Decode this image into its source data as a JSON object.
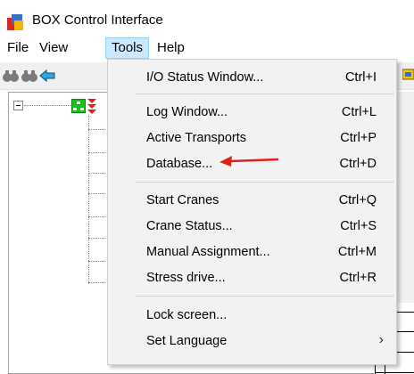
{
  "window": {
    "title": "BOX Control Interface"
  },
  "menubar": {
    "file": "File",
    "view": "View",
    "tools": "Tools",
    "help": "Help"
  },
  "tools_menu": {
    "io_status": {
      "label": "I/O Status Window...",
      "shortcut": "Ctrl+I"
    },
    "log_window": {
      "label": "Log Window...",
      "shortcut": "Ctrl+L"
    },
    "active_transports": {
      "label": "Active Transports",
      "shortcut": "Ctrl+P"
    },
    "database": {
      "label": "Database...",
      "shortcut": "Ctrl+D"
    },
    "start_cranes": {
      "label": "Start Cranes",
      "shortcut": "Ctrl+Q"
    },
    "crane_status": {
      "label": "Crane Status...",
      "shortcut": "Ctrl+S"
    },
    "manual_assignment": {
      "label": "Manual Assignment...",
      "shortcut": "Ctrl+M"
    },
    "stress_drive": {
      "label": "Stress drive...",
      "shortcut": "Ctrl+R"
    },
    "lock_screen": {
      "label": "Lock screen..."
    },
    "set_language": {
      "label": "Set Language",
      "submenu_glyph": "›"
    }
  },
  "colors": {
    "menu_highlight": "#cce8ff",
    "annotation_arrow": "#e0201b",
    "tree_node": "#19c219"
  },
  "icons": [
    "app-icon",
    "binoculars-icon",
    "binoculars-icon",
    "back-arrow-icon",
    "network-node-icon",
    "red-node-icon"
  ]
}
